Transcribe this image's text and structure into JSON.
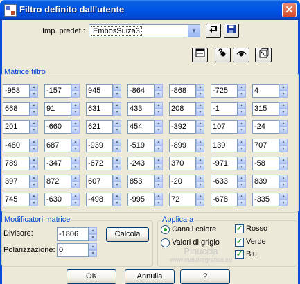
{
  "window": {
    "title": "Filtro definito dall'utente",
    "close_label": "✕"
  },
  "preset": {
    "label": "Imp. predef.:",
    "value": "EmbosSuiza3",
    "arrow": "▼"
  },
  "matrix_group": {
    "label": "Matrice filtro",
    "rows": [
      [
        "-953",
        "-157",
        "945",
        "-864",
        "-868",
        "-725",
        "4"
      ],
      [
        "668",
        "91",
        "631",
        "433",
        "208",
        "-1",
        "315"
      ],
      [
        "201",
        "-660",
        "621",
        "454",
        "-392",
        "107",
        "-24"
      ],
      [
        "-480",
        "687",
        "-939",
        "-519",
        "-899",
        "139",
        "707"
      ],
      [
        "789",
        "-347",
        "-672",
        "-243",
        "370",
        "-971",
        "-58"
      ],
      [
        "397",
        "872",
        "607",
        "853",
        "-20",
        "-633",
        "839"
      ],
      [
        "745",
        "-630",
        "-498",
        "-995",
        "72",
        "-678",
        "-335"
      ]
    ]
  },
  "modifiers": {
    "label": "Modificatori matrice",
    "divisor_label": "Divisore:",
    "divisor_value": "-1806",
    "calc_label": "Calcola",
    "bias_label": "Polarizzazione:",
    "bias_value": "0"
  },
  "apply": {
    "label": "Applica a",
    "radio_color": "Canali colore",
    "radio_gray": "Valori di grigio",
    "cb_red": "Rosso",
    "cb_green": "Verde",
    "cb_blue": "Blu"
  },
  "buttons": {
    "ok": "OK",
    "cancel": "Annulla",
    "help": "?"
  },
  "watermark": {
    "line1": "Pinuccia",
    "line2": "www.maidiregrafica.eu"
  },
  "colors": {
    "titlebar": "#0055e5",
    "group_label": "#0046d5",
    "dialog_bg": "#ece9d8",
    "check_green": "#21a121"
  }
}
